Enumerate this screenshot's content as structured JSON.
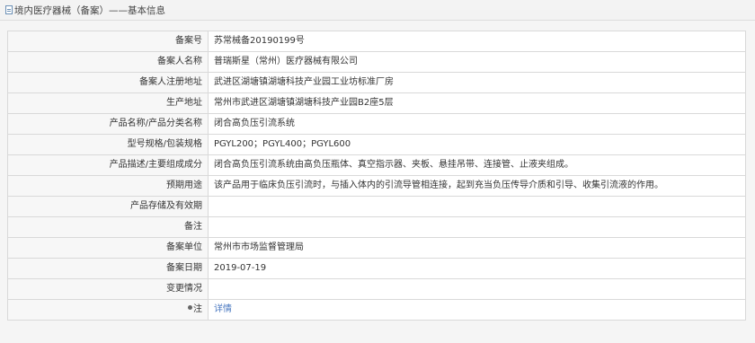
{
  "header": {
    "title": "境内医疗器械（备案）",
    "subtitle": "——基本信息"
  },
  "fields": [
    {
      "label": "备案号",
      "value": "苏常械备20190199号"
    },
    {
      "label": "备案人名称",
      "value": "普瑞斯星（常州）医疗器械有限公司"
    },
    {
      "label": "备案人注册地址",
      "value": "武进区湖塘镇湖塘科技产业园工业坊标准厂房"
    },
    {
      "label": "生产地址",
      "value": "常州市武进区湖塘镇湖塘科技产业园B2座5层"
    },
    {
      "label": "产品名称/产品分类名称",
      "value": "闭合高负压引流系统"
    },
    {
      "label": "型号规格/包装规格",
      "value": "PGYL200；PGYL400；PGYL600"
    },
    {
      "label": "产品描述/主要组成成分",
      "value": "闭合高负压引流系统由高负压瓶体、真空指示器、夹板、悬挂吊带、连接管、止液夹组成。"
    },
    {
      "label": "预期用途",
      "value": "该产品用于临床负压引流时，与插入体内的引流导管相连接，起到充当负压传导介质和引导、收集引流液的作用。"
    },
    {
      "label": "产品存储及有效期",
      "value": ""
    },
    {
      "label": "备注",
      "value": ""
    },
    {
      "label": "备案单位",
      "value": "常州市市场监督管理局"
    },
    {
      "label": "备案日期",
      "value": "2019-07-19"
    },
    {
      "label": "变更情况",
      "value": ""
    }
  ],
  "note_row": {
    "label": "注",
    "link": "详情"
  },
  "colors": {
    "link": "#4a78c0",
    "border": "#d9d9d9",
    "header_bg": "#f3f3f3"
  },
  "icons": [
    "document-icon",
    "pin-icon"
  ]
}
